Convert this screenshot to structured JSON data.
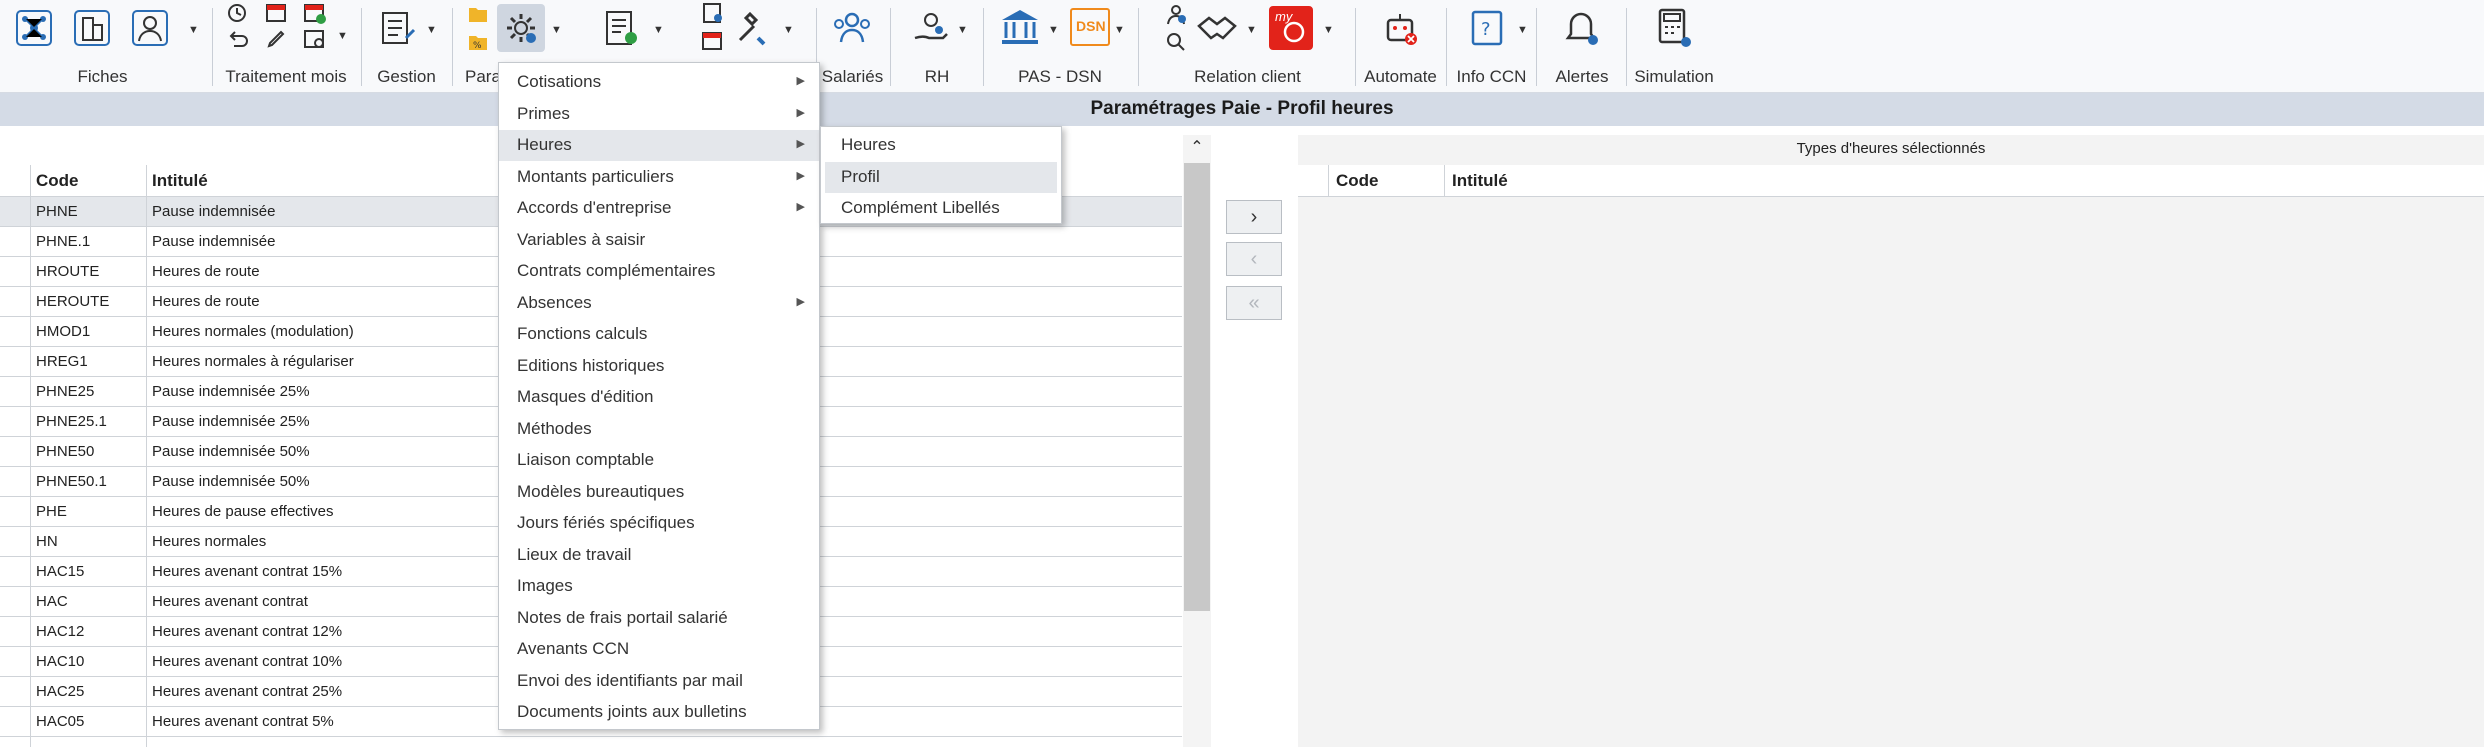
{
  "ribbon": {
    "groups": {
      "fiches": "Fiches",
      "traitement_mois": "Traitement mois",
      "gestion": "Gestion",
      "parametres": "Para",
      "salaries": "Salariés",
      "rh": "RH",
      "pas_dsn": "PAS - DSN",
      "relation_client": "Relation client",
      "automate": "Automate",
      "info_ccn": "Info CCN",
      "alertes": "Alertes",
      "simulation": "Simulation"
    },
    "icons": {
      "dsn_text": "DSN",
      "my_text": "my"
    }
  },
  "titlebar": {
    "title": "Paramétrages Paie - Profil heures"
  },
  "left_panel": {
    "headers": {
      "code": "Code",
      "intitule": "Intitulé"
    },
    "rows": [
      {
        "code": "PHNE",
        "intitule": "Pause indemnisée",
        "selected": true
      },
      {
        "code": "PHNE.1",
        "intitule": "Pause indemnisée"
      },
      {
        "code": "HROUTE",
        "intitule": "Heures de route"
      },
      {
        "code": "HEROUTE",
        "intitule": "Heures de route"
      },
      {
        "code": "HMOD1",
        "intitule": "Heures normales (modulation)"
      },
      {
        "code": "HREG1",
        "intitule": "Heures normales à régulariser"
      },
      {
        "code": "PHNE25",
        "intitule": "Pause indemnisée 25%"
      },
      {
        "code": "PHNE25.1",
        "intitule": "Pause indemnisée  25%"
      },
      {
        "code": "PHNE50",
        "intitule": "Pause indemnisée 50%"
      },
      {
        "code": "PHNE50.1",
        "intitule": "Pause indemnisée 50%"
      },
      {
        "code": "PHE",
        "intitule": "Heures de pause effectives"
      },
      {
        "code": "HN",
        "intitule": "Heures normales"
      },
      {
        "code": "HAC15",
        "intitule": "Heures avenant contrat 15%"
      },
      {
        "code": "HAC",
        "intitule": "Heures avenant contrat"
      },
      {
        "code": "HAC12",
        "intitule": "Heures avenant contrat 12%"
      },
      {
        "code": "HAC10",
        "intitule": "Heures avenant contrat 10%"
      },
      {
        "code": "HAC25",
        "intitule": "Heures avenant contrat 25%"
      },
      {
        "code": "HAC05",
        "intitule": "Heures avenant contrat 5%"
      }
    ]
  },
  "transfer": {
    "add": "›",
    "remove": "‹",
    "remove_all": "«"
  },
  "right_panel": {
    "title": "Types d'heures sélectionnés",
    "headers": {
      "code": "Code",
      "intitule": "Intitulé"
    }
  },
  "menu": {
    "items": [
      {
        "label": "Cotisations",
        "submenu": true
      },
      {
        "label": "Primes",
        "submenu": true
      },
      {
        "label": "Heures",
        "submenu": true,
        "highlighted": true
      },
      {
        "label": "Montants particuliers",
        "submenu": true
      },
      {
        "label": "Accords d'entreprise",
        "submenu": true
      },
      {
        "label": "Variables à saisir"
      },
      {
        "label": "Contrats complémentaires"
      },
      {
        "label": "Absences",
        "submenu": true
      },
      {
        "label": "Fonctions calculs"
      },
      {
        "label": "Editions historiques"
      },
      {
        "label": "Masques d'édition"
      },
      {
        "label": "Méthodes"
      },
      {
        "label": "Liaison comptable"
      },
      {
        "label": "Modèles bureautiques"
      },
      {
        "label": "Jours fériés spécifiques"
      },
      {
        "label": "Lieux de travail"
      },
      {
        "label": "Images"
      },
      {
        "label": "Notes de frais portail salarié"
      },
      {
        "label": "Avenants CCN"
      },
      {
        "label": "Envoi des identifiants par mail"
      },
      {
        "label": "Documents joints aux bulletins"
      }
    ]
  },
  "submenu": {
    "items": [
      {
        "label": "Heures"
      },
      {
        "label": "Profil",
        "highlighted": true
      },
      {
        "label": "Complément Libellés"
      }
    ]
  },
  "colors": {
    "accent_blue": "#2a6db5",
    "accent_red": "#e2231a",
    "accent_orange": "#f08a1c",
    "titlebar_bg": "#d4dbe6"
  }
}
